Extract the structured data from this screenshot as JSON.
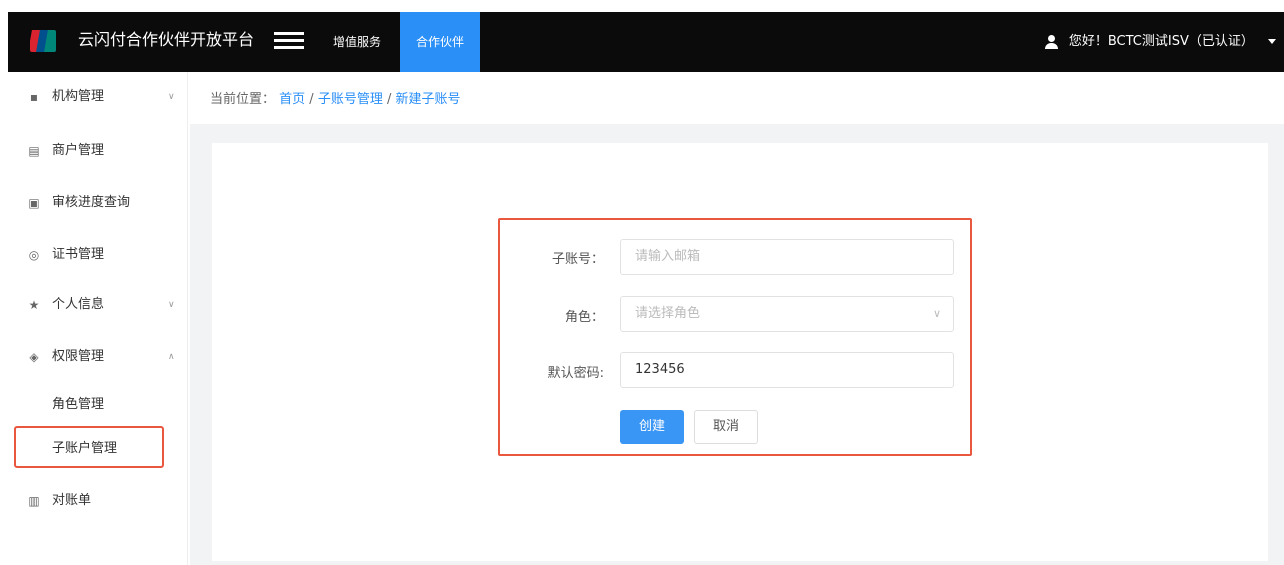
{
  "header": {
    "title": "云闪付合作伙伴开放平台",
    "nav": [
      "增值服务",
      "合作伙伴"
    ],
    "user_text": "您好！BCTC测试ISV（已认证）"
  },
  "sidebar": {
    "items": [
      {
        "label": "机构管理",
        "icon": "grid-icon",
        "chevron": "∨"
      },
      {
        "label": "商户管理",
        "icon": "store-icon"
      },
      {
        "label": "审核进度查询",
        "icon": "clipboard-icon"
      },
      {
        "label": "证书管理",
        "icon": "certificate-icon"
      },
      {
        "label": "个人信息",
        "icon": "star-icon",
        "chevron": "∨"
      },
      {
        "label": "权限管理",
        "icon": "permission-icon",
        "chevron": "∧"
      },
      {
        "label": "角色管理"
      },
      {
        "label": "子账户管理"
      },
      {
        "label": "对账单",
        "icon": "statement-icon"
      }
    ]
  },
  "breadcrumb": {
    "prefix": "当前位置：",
    "items": [
      "首页",
      "子账号管理",
      "新建子账号"
    ],
    "sep": " / "
  },
  "form": {
    "subaccount_label": "子账号：",
    "subaccount_placeholder": "请输入邮箱",
    "role_label": "角色：",
    "role_placeholder": "请选择角色",
    "password_label": "默认密码:",
    "password_value": "123456",
    "create_label": "创建",
    "cancel_label": "取消"
  },
  "colors": {
    "accent": "#2a8ff7",
    "highlight_border": "#e9573f",
    "topbar": "#0b0b0b"
  }
}
